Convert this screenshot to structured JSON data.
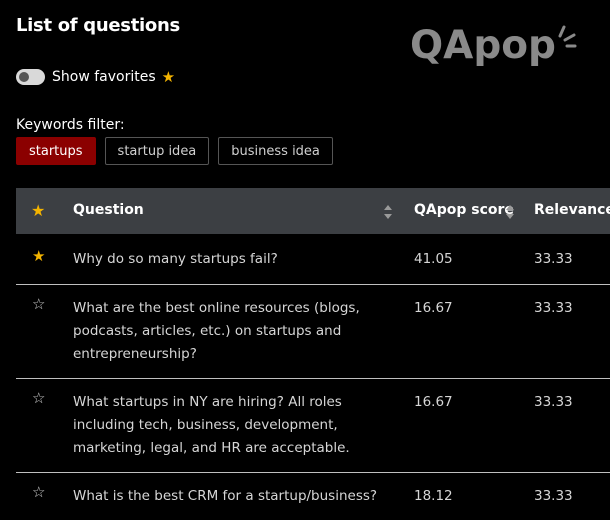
{
  "header": {
    "title": "List of questions",
    "logo_text": "QApop"
  },
  "favorites": {
    "label": "Show favorites",
    "enabled": false,
    "star_glyph": "★"
  },
  "filters": {
    "label": "Keywords filter:",
    "chips": [
      {
        "label": "startups",
        "active": true
      },
      {
        "label": "startup idea",
        "active": false
      },
      {
        "label": "business idea",
        "active": false
      }
    ]
  },
  "table": {
    "headers": {
      "star": "★",
      "question": "Question",
      "score": "QApop score",
      "relevance": "Relevance"
    },
    "rows": [
      {
        "favorite": true,
        "star": "★",
        "question": "Why do so many startups fail?",
        "score": "41.05",
        "relevance": "33.33"
      },
      {
        "favorite": false,
        "star": "☆",
        "question": "What are the best online resources (blogs, podcasts, articles, etc.) on startups and entrepreneurship?",
        "score": "16.67",
        "relevance": "33.33"
      },
      {
        "favorite": false,
        "star": "☆",
        "question": "What startups in NY are hiring? All roles including tech, business, development, marketing, legal, and HR are acceptable.",
        "score": "16.67",
        "relevance": "33.33"
      },
      {
        "favorite": false,
        "star": "☆",
        "question": "What is the best CRM for a startup/business?",
        "score": "18.12",
        "relevance": "33.33"
      }
    ]
  },
  "colors": {
    "accent_chip": "#8b0000",
    "star_gold": "#f4b400",
    "header_bg": "#3c3f43"
  }
}
